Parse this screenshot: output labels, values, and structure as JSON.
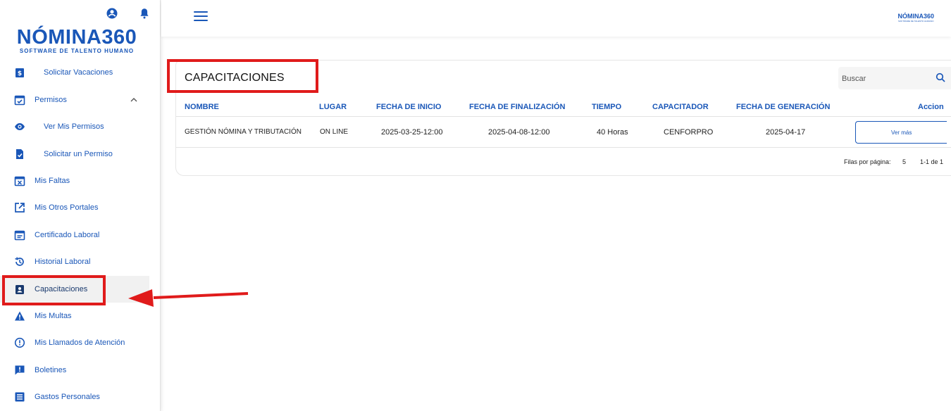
{
  "brand": {
    "name": "NÓMINA360",
    "tagline": "SOFTWARE DE TALENTO HUMANO"
  },
  "topbar": {
    "mini_logo": "NÓMINA360",
    "mini_tagline": "SOFTWARE DE TALENTO HUMANO"
  },
  "sidebar": {
    "items": [
      {
        "label": "Solicitar Vacaciones",
        "icon": "dollar-doc-icon"
      },
      {
        "label": "Permisos",
        "icon": "calendar-check-icon"
      },
      {
        "label": "Ver Mis Permisos",
        "icon": "eye-icon"
      },
      {
        "label": "Solicitar un Permiso",
        "icon": "doc-check-icon"
      },
      {
        "label": "Mis Faltas",
        "icon": "calendar-x-icon"
      },
      {
        "label": "Mis Otros Portales",
        "icon": "external-link-icon"
      },
      {
        "label": "Certificado Laboral",
        "icon": "calendar-lines-icon"
      },
      {
        "label": "Historial Laboral",
        "icon": "history-icon"
      },
      {
        "label": "Capacitaciones",
        "icon": "badge-icon"
      },
      {
        "label": "Mis Multas",
        "icon": "warning-icon"
      },
      {
        "label": "Mis Llamados de Atención",
        "icon": "alert-circle-icon"
      },
      {
        "label": "Boletines",
        "icon": "message-alert-icon"
      },
      {
        "label": "Gastos Personales",
        "icon": "list-icon"
      }
    ]
  },
  "main": {
    "title": "CAPACITACIONES",
    "search_placeholder": "Buscar",
    "table": {
      "headers": [
        "NOMBRE",
        "LUGAR",
        "FECHA DE INICIO",
        "FECHA DE FINALIZACIÓN",
        "TIEMPO",
        "CAPACITADOR",
        "FECHA DE GENERACIÓN",
        "Accion"
      ],
      "rows": [
        [
          "GESTIÓN NÓMINA Y TRIBUTACIÓN",
          "ON LINE",
          "2025-03-25-12:00",
          "2025-04-08-12:00",
          "40 Horas",
          "CENFORPRO",
          "2025-04-17",
          "Ver más"
        ]
      ]
    },
    "pager": {
      "rows_label": "Filas por página:",
      "rows_value": "5",
      "range": "1-1 de 1"
    }
  },
  "colors": {
    "accent": "#1a57b8",
    "highlight": "#e01b1b"
  }
}
